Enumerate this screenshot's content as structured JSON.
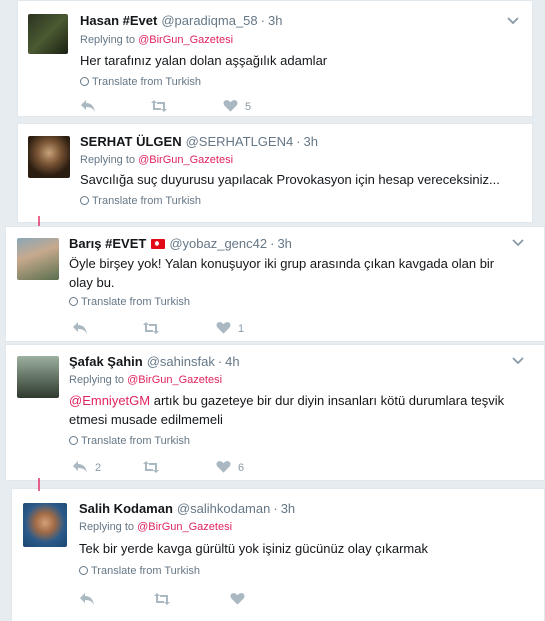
{
  "tweets": [
    {
      "name": "Hasan #Evet",
      "handle": "@paradiqma_58",
      "time": "3h",
      "replying_prefix": "Replying to",
      "replying_to": "@BirGun_Gazetesi",
      "text": "Her tarafınız yalan dolan aşşağılık adamlar",
      "translate": "Translate from Turkish",
      "reply_count": "",
      "retweet_count": "",
      "like_count": "5"
    },
    {
      "name": "SERHAT ÜLGEN",
      "handle": "@SERHATLGEN4",
      "time": "3h",
      "replying_prefix": "Replying to",
      "replying_to": "@BirGun_Gazetesi",
      "text": "Savcılığa suç duyurusu yapılacak Provokasyon için hesap vereceksiniz...",
      "translate": "Translate from Turkish"
    },
    {
      "name": "Barış #EVET",
      "handle": "@yobaz_genc42",
      "time": "3h",
      "text": "Öyle birşey yok! Yalan konuşuyor iki grup arasında çıkan kavgada olan bir olay bu.",
      "translate": "Translate from Turkish",
      "reply_count": "",
      "retweet_count": "",
      "like_count": "1"
    },
    {
      "name": "Şafak Şahin",
      "handle": "@sahinsfak",
      "time": "4h",
      "replying_prefix": "Replying to",
      "replying_to": "@BirGun_Gazetesi",
      "text_mention": "@EmniyetGM",
      "text": " artık bu gazeteye bir dur diyin insanları kötü durumlara teşvik etmesi musade edilmemeli",
      "translate": "Translate from Turkish",
      "reply_count": "2",
      "retweet_count": "",
      "like_count": "6"
    },
    {
      "name": "Salih Kodaman",
      "handle": "@salihkodaman",
      "time": "3h",
      "replying_prefix": "Replying to",
      "replying_to": "@BirGun_Gazetesi",
      "text": "Tek bir yerde kavga gürültü yok işiniz gücünüz olay çıkarmak",
      "translate": "Translate from Turkish",
      "reply_count": "",
      "retweet_count": "",
      "like_count": ""
    }
  ],
  "colors": {
    "mention": "#e0245e",
    "secondary_text": "#657786",
    "icon": "#aab8c2",
    "background": "#e6ecf0"
  }
}
